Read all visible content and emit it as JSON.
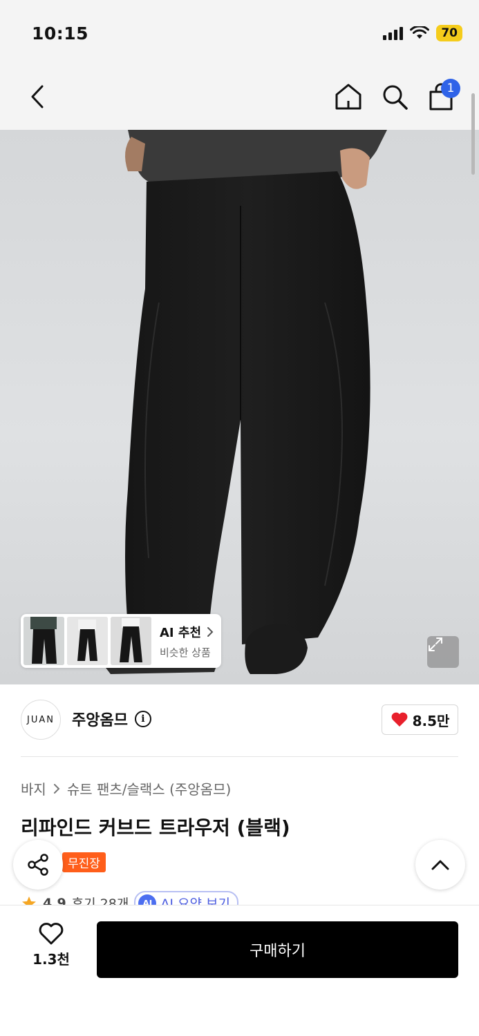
{
  "status_bar": {
    "time": "10:15",
    "battery": "70"
  },
  "header": {
    "cart_count": "1"
  },
  "hero": {
    "ai_card": {
      "title": "AI 추천",
      "subtitle": "비슷한 상품"
    }
  },
  "brand": {
    "logo_text": "JUAN",
    "name": "주앙옴므",
    "likes": "8.5만"
  },
  "product": {
    "breadcrumb": [
      "바지",
      "슈트 팬츠/슬랙스 (주앙옴므)"
    ],
    "title": "리파인드 커브드 트라우저 (블랙)",
    "badge": "무진장",
    "rating": "4.9",
    "reviews": "후기 28개",
    "ai_summary": "AI 요약 보기"
  },
  "bottom_bar": {
    "wish_count": "1.3천",
    "buy_label": "구매하기"
  },
  "colors": {
    "accent_blue": "#2f63e8",
    "badge_orange": "#ff5e1a",
    "battery_yellow": "#f5cc1b",
    "heart_red": "#e8202c"
  }
}
